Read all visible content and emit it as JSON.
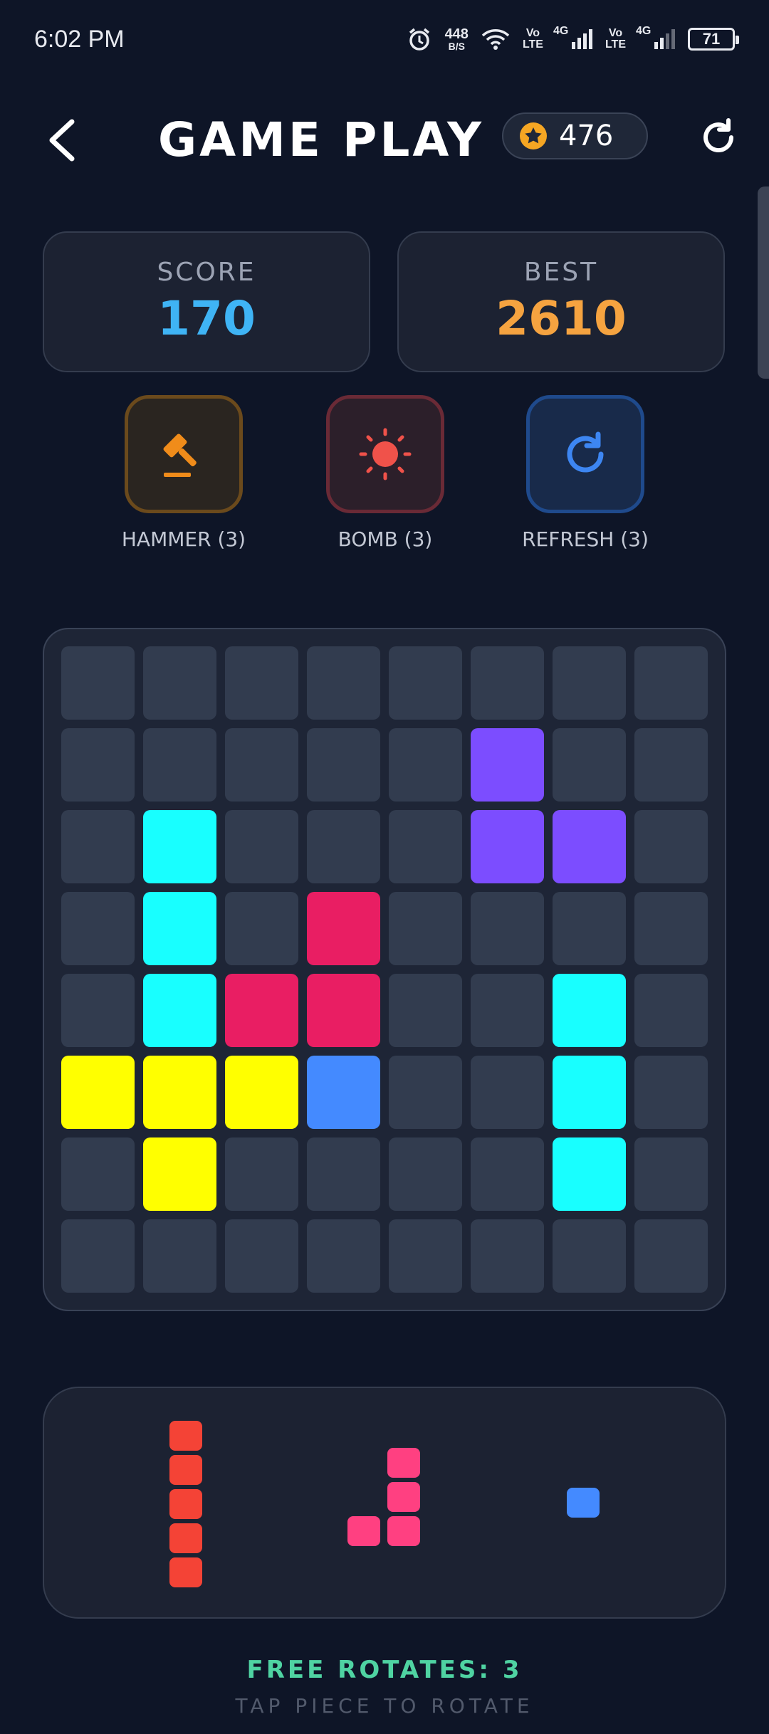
{
  "status_bar": {
    "time": "6:02 PM",
    "net_speed_value": "448",
    "net_speed_unit": "B/S",
    "volte_top": "Vo",
    "volte_bottom": "LTE",
    "network_type": "4G",
    "battery": "71"
  },
  "header": {
    "title": "GAME PLAY",
    "coins": "476",
    "icons": [
      "back-arrow-icon",
      "star-coin-icon",
      "restart-icon"
    ]
  },
  "scores": {
    "score_label": "SCORE",
    "score_value": "170",
    "best_label": "BEST",
    "best_value": "2610"
  },
  "powerups": [
    {
      "label": "HAMMER (3)",
      "icon": "hammer-icon",
      "color": "#f08c1a"
    },
    {
      "label": "BOMB (3)",
      "icon": "bomb-icon",
      "color": "#f0524a"
    },
    {
      "label": "REFRESH (3)",
      "icon": "refresh-icon",
      "color": "#3d86f2"
    }
  ],
  "board": {
    "size": 8,
    "empty_color": "#323c4f",
    "filled": [
      {
        "row": 1,
        "col": 5,
        "color": "#7c4dff"
      },
      {
        "row": 2,
        "col": 1,
        "color": "#18ffff"
      },
      {
        "row": 2,
        "col": 5,
        "color": "#7c4dff"
      },
      {
        "row": 2,
        "col": 6,
        "color": "#7c4dff"
      },
      {
        "row": 3,
        "col": 1,
        "color": "#18ffff"
      },
      {
        "row": 3,
        "col": 3,
        "color": "#e91e63"
      },
      {
        "row": 4,
        "col": 1,
        "color": "#18ffff"
      },
      {
        "row": 4,
        "col": 2,
        "color": "#e91e63"
      },
      {
        "row": 4,
        "col": 3,
        "color": "#e91e63"
      },
      {
        "row": 4,
        "col": 6,
        "color": "#18ffff"
      },
      {
        "row": 5,
        "col": 0,
        "color": "#ffff00"
      },
      {
        "row": 5,
        "col": 1,
        "color": "#ffff00"
      },
      {
        "row": 5,
        "col": 2,
        "color": "#ffff00"
      },
      {
        "row": 5,
        "col": 3,
        "color": "#448aff"
      },
      {
        "row": 5,
        "col": 6,
        "color": "#18ffff"
      },
      {
        "row": 6,
        "col": 1,
        "color": "#ffff00"
      },
      {
        "row": 6,
        "col": 6,
        "color": "#18ffff"
      }
    ]
  },
  "tray": {
    "pieces": [
      {
        "name": "i-piece-vertical",
        "color": "#f44336",
        "cells": [
          [
            0,
            0
          ],
          [
            1,
            0
          ],
          [
            2,
            0
          ],
          [
            3,
            0
          ],
          [
            4,
            0
          ]
        ]
      },
      {
        "name": "j-piece",
        "color": "#ff4081",
        "cells": [
          [
            0,
            1
          ],
          [
            1,
            1
          ],
          [
            2,
            0
          ],
          [
            2,
            1
          ]
        ]
      },
      {
        "name": "single-piece",
        "color": "#448aff",
        "cells": [
          [
            0,
            0
          ]
        ]
      }
    ]
  },
  "footer": {
    "rotates_text": "FREE ROTATES: 3",
    "hint_text": "TAP PIECE TO ROTATE"
  }
}
